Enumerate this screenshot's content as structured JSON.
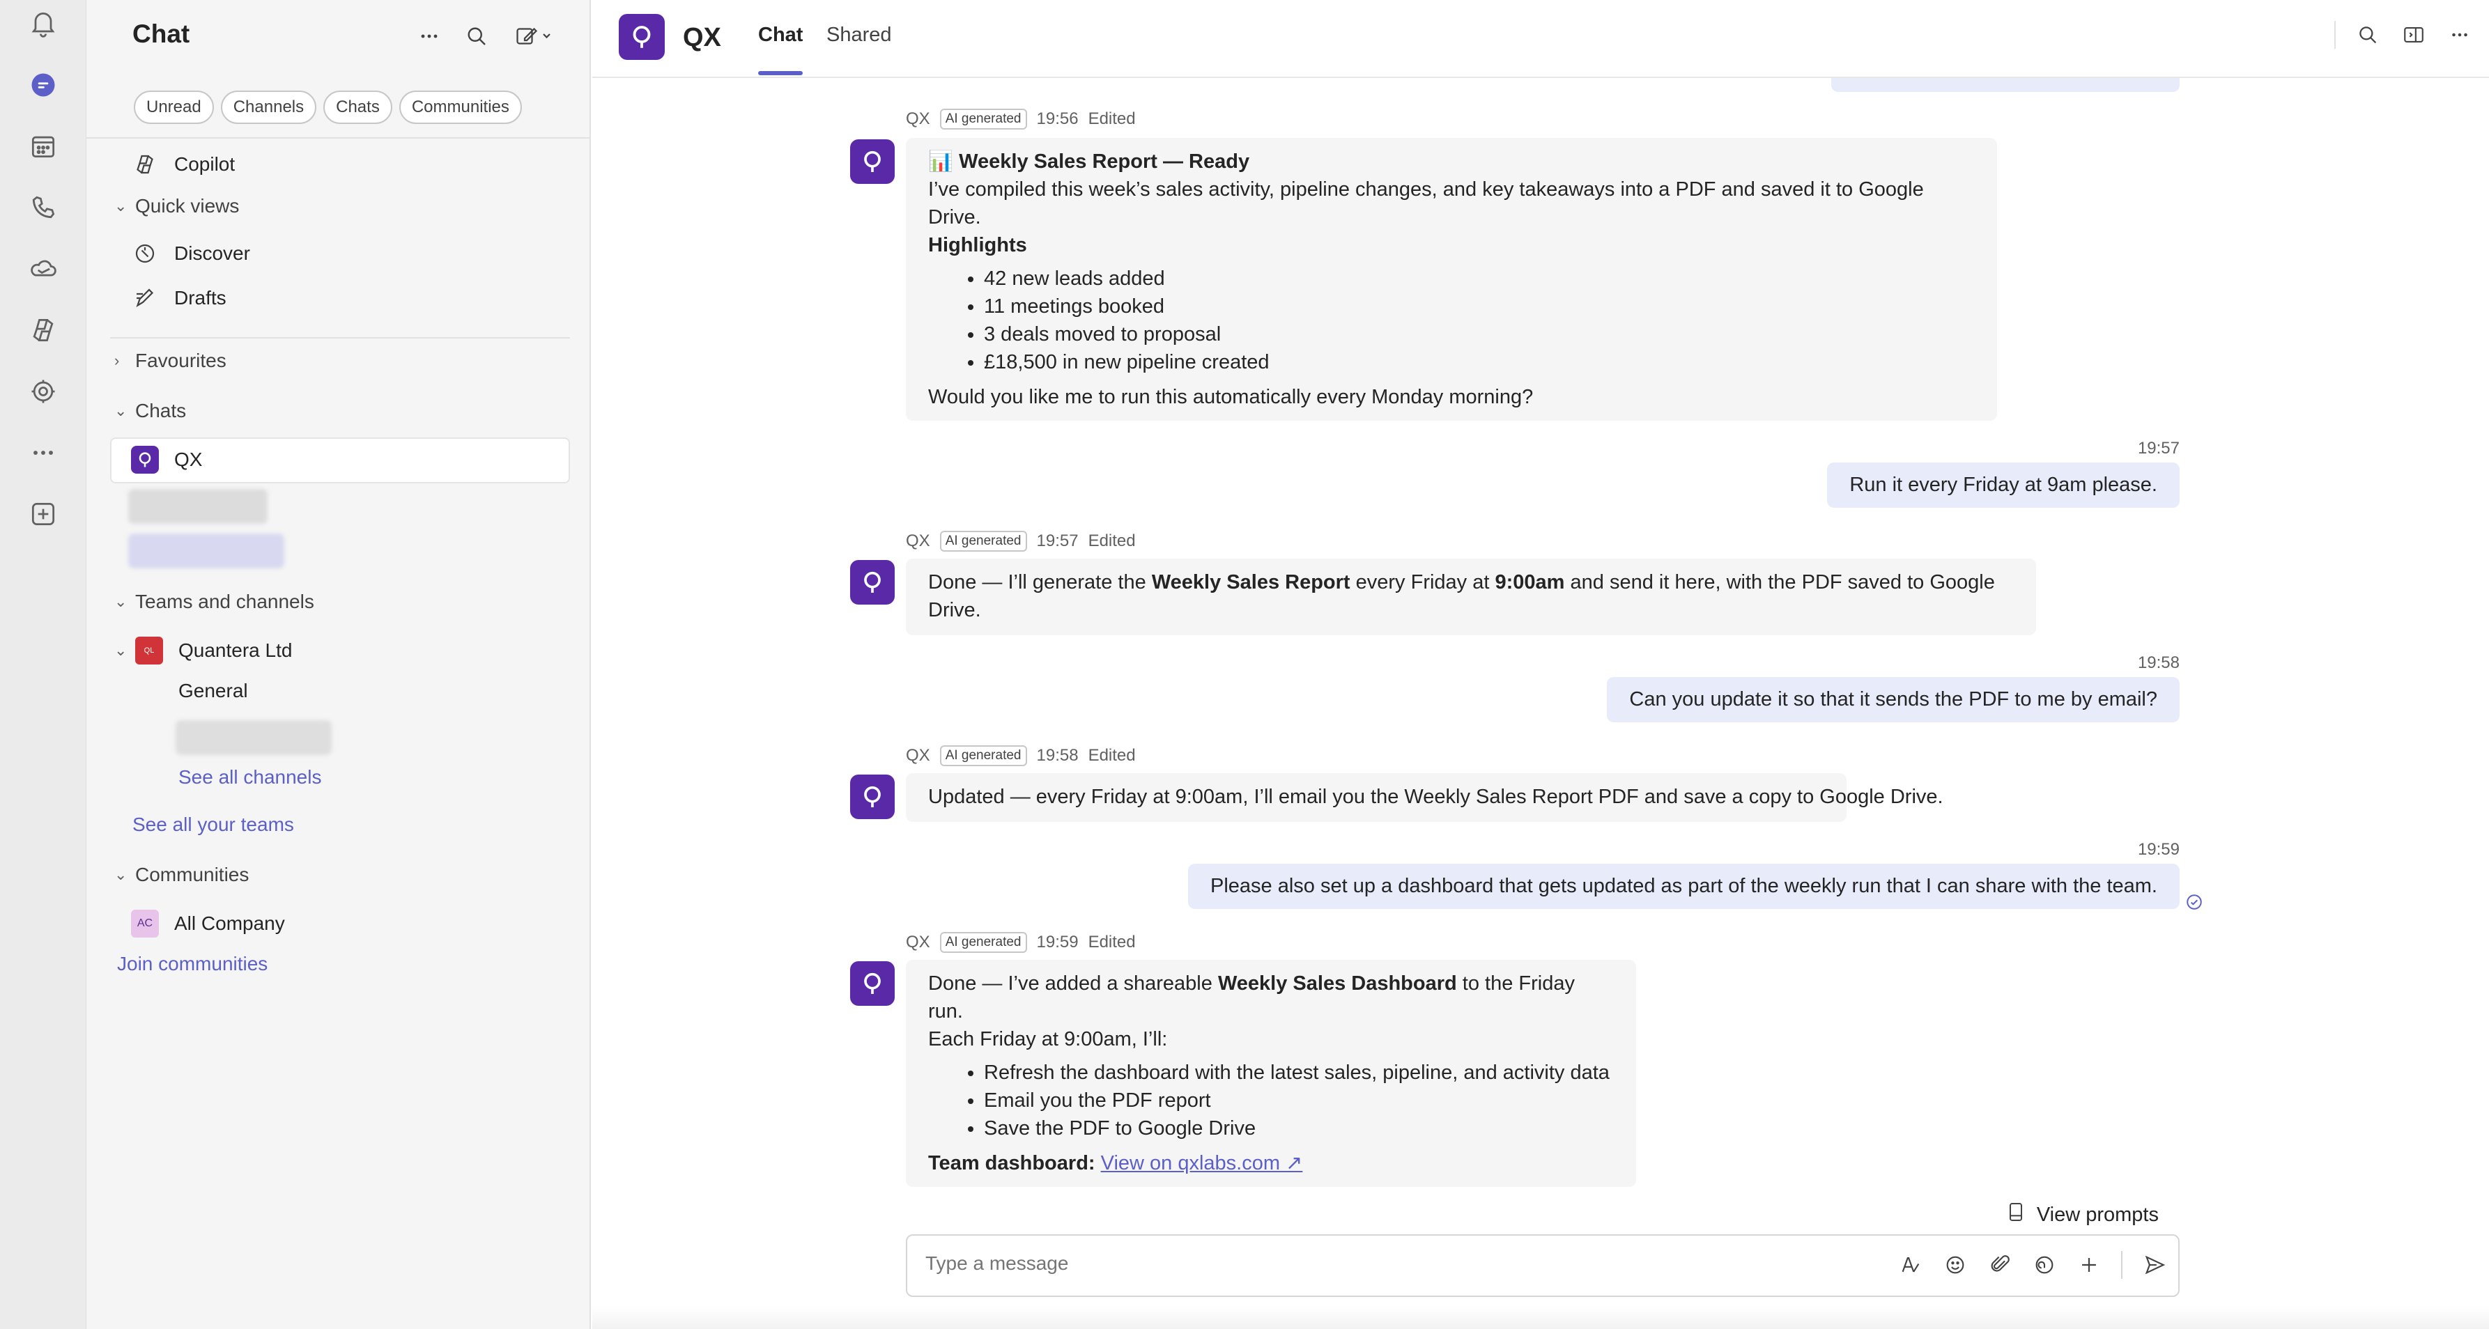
{
  "colors": {
    "accent": "#5b5fc7",
    "bot_avatar": "#5a29a8",
    "team_badge": "#d13438",
    "community_badge": "#e8c4ea",
    "me_bubble": "#e8ebfa"
  },
  "rail": {
    "icons": [
      "bell-icon",
      "chat-icon",
      "calendar-icon",
      "phone-icon",
      "onedrive-icon",
      "copilot-icon",
      "apps-icon",
      "more-icon",
      "add-app-icon"
    ]
  },
  "pane": {
    "title": "Chat",
    "filters": [
      "Unread",
      "Channels",
      "Chats",
      "Communities"
    ],
    "copilot": "Copilot",
    "quick_views": "Quick views",
    "discover": "Discover",
    "drafts": "Drafts",
    "favourites": "Favourites",
    "chats": "Chats",
    "chat_qx": "QX",
    "teams_and_channels": "Teams and channels",
    "team_name": "Quantera Ltd",
    "team_initials": "QL",
    "channel_general": "General",
    "see_all_channels": "See all channels",
    "see_all_teams": "See all your teams",
    "communities": "Communities",
    "community_initials": "AC",
    "community_name": "All Company",
    "join_communities": "Join communities"
  },
  "header": {
    "title": "QX",
    "tabs": [
      "Chat",
      "Shared"
    ]
  },
  "messages": [
    {
      "sender": "QX",
      "badge": "AI generated",
      "time": "19:56",
      "edited": "Edited",
      "title": "📊 Weekly Sales Report — Ready",
      "intro": "I’ve compiled this week’s sales activity, pipeline changes, and key takeaways into a PDF and saved it to Google Drive.",
      "highlights_label": "Highlights",
      "bullets": [
        "42 new leads added",
        "11 meetings booked",
        "3 deals moved to proposal",
        "£18,500 in new pipeline created"
      ],
      "outro": "Would you like me to run this automatically every Monday morning?"
    },
    {
      "me_time": "19:57",
      "me_text": "Run it every Friday at 9am please."
    },
    {
      "sender": "QX",
      "badge": "AI generated",
      "time": "19:57",
      "edited": "Edited",
      "t1": "Done — I’ll generate the ",
      "b1": "Weekly Sales Report",
      "t2": " every Friday at ",
      "b2": "9:00am",
      "t3": " and send it here, with the PDF saved to Google Drive."
    },
    {
      "me_time": "19:58",
      "me_text": "Can you update it so that it sends the PDF to me by email?"
    },
    {
      "sender": "QX",
      "badge": "AI generated",
      "time": "19:58",
      "edited": "Edited",
      "text": "Updated — every Friday at 9:00am, I’ll email you the Weekly Sales Report PDF and save a copy to Google Drive."
    },
    {
      "me_time": "19:59",
      "me_text": "Please also set up a dashboard that gets updated as part of the weekly run that I can share with the team."
    },
    {
      "sender": "QX",
      "badge": "AI generated",
      "time": "19:59",
      "edited": "Edited",
      "t1": "Done — I’ve added a shareable ",
      "b1": "Weekly Sales Dashboard",
      "t2": " to the Friday run.",
      "line2": "Each Friday at 9:00am, I’ll:",
      "bullets": [
        "Refresh the dashboard with the latest sales, pipeline, and activity data",
        "Email you the PDF report",
        "Save the PDF to Google Drive"
      ],
      "dash_label": "Team dashboard:",
      "dash_link": "View on qxlabs.com ↗"
    }
  ],
  "composer": {
    "view_prompts": "View prompts",
    "placeholder": "Type a message"
  }
}
